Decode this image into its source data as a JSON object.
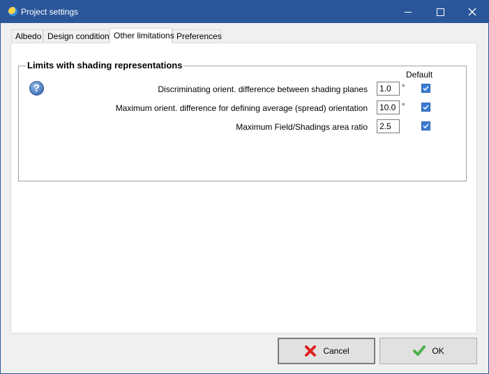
{
  "window": {
    "title": "Project settings"
  },
  "tabs": [
    {
      "label": "Albedo"
    },
    {
      "label": "Design conditions"
    },
    {
      "label": "Other limitations",
      "active": true
    },
    {
      "label": "Preferences"
    }
  ],
  "group": {
    "title": "Limits with shading representations",
    "default_label": "Default",
    "rows": [
      {
        "label": "Discriminating orient. difference between shading planes",
        "value": "1.0",
        "unit": "°",
        "default_checked": true
      },
      {
        "label": "Maximum orient. difference for defining average (spread) orientation",
        "value": "10.0",
        "unit": "°",
        "default_checked": true
      },
      {
        "label": "Maximum Field/Shadings area ratio",
        "value": "2.5",
        "unit": "",
        "default_checked": true
      }
    ]
  },
  "buttons": {
    "cancel": "Cancel",
    "ok": "OK"
  },
  "colors": {
    "titlebar": "#2b579a",
    "checkbox": "#3a7bd5",
    "cancel_icon": "#e02020",
    "ok_icon": "#4caf50"
  }
}
